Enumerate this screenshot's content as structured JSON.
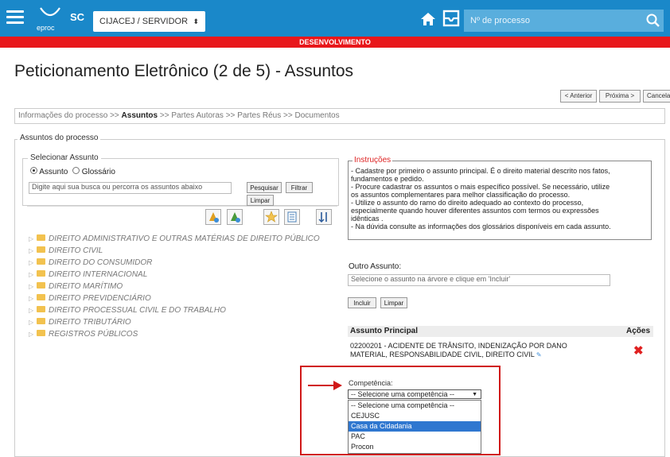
{
  "header": {
    "logo_text": "eproc",
    "state": "SC",
    "org_select": "CIJACEJ / SERVIDOR",
    "process_search_placeholder": "Nº de processo",
    "environment": "DESENVOLVIMENTO",
    "colors": {
      "bar": "#1a88c9",
      "env": "#e8171b"
    }
  },
  "page": {
    "title": "Peticionamento Eletrônico (2 de 5) - Assuntos",
    "nav_buttons": {
      "previous": "< Anterior",
      "next": "Próxima >",
      "cancel": "Cancelar"
    }
  },
  "breadcrumb": {
    "step1": "Informações do processo",
    "sep": ">>",
    "step2": "Assuntos",
    "step3": "Partes Autoras",
    "step4": "Partes Réus",
    "step5": "Documentos"
  },
  "subjects": {
    "legend": "Assuntos do processo",
    "select_legend": "Selecionar Assunto",
    "radio_subject": "Assunto",
    "radio_glossary": "Glossário",
    "search_placeholder": "Digite aqui sua busca ou percorra os assuntos abaixo",
    "search_btn": "Pesquisar",
    "filter_btn": "Filtrar",
    "clear_btn": "Limpar",
    "tree": [
      "DIREITO ADMINISTRATIVO E OUTRAS MATÉRIAS DE DIREITO PÚBLICO",
      "DIREITO CIVIL",
      "DIREITO DO CONSUMIDOR",
      "DIREITO INTERNACIONAL",
      "DIREITO MARÍTIMO",
      "DIREITO PREVIDENCIÁRIO",
      "DIREITO PROCESSUAL CIVIL E DO TRABALHO",
      "DIREITO TRIBUTÁRIO",
      "REGISTROS PÚBLICOS"
    ]
  },
  "instructions": {
    "title": "Instruções",
    "lines": [
      "- Cadastre por primeiro o assunto principal. É o direito material descrito nos fatos,",
      "fundamentos e pedido.",
      "- Procure cadastrar os assuntos o mais específico possível. Se necessário, utilize",
      "os assuntos complementares para melhor classificação do processo.",
      "- Utilize o assunto do ramo do direito adequado ao contexto do processo,",
      "especialmente quando houver diferentes assuntos com termos ou expressões",
      "idênticas .",
      "- Na dúvida consulte as informações dos glossários disponíveis em cada assunto."
    ]
  },
  "other_subject": {
    "label": "Outro Assunto:",
    "placeholder": "Selecione o assunto na árvore e clique em 'Incluir'",
    "include_btn": "Incluir",
    "clear_btn": "Limpar"
  },
  "main_subject": {
    "header": "Assunto Principal",
    "actions_header": "Ações",
    "line1": "02200201 - ACIDENTE DE TRÂNSITO, INDENIZAÇÃO POR DANO",
    "line2": "MATERIAL, RESPONSABILIDADE CIVIL, DIREITO CIVIL"
  },
  "competence": {
    "label": "Competência:",
    "selected": "-- Selecione uma competência --",
    "options": [
      "-- Selecione uma competência --",
      "CEJUSC",
      "Casa da Cidadania",
      "PAC",
      "Procon"
    ],
    "highlighted": "Casa da Cidadania",
    "highlight_color": "#d01818"
  }
}
